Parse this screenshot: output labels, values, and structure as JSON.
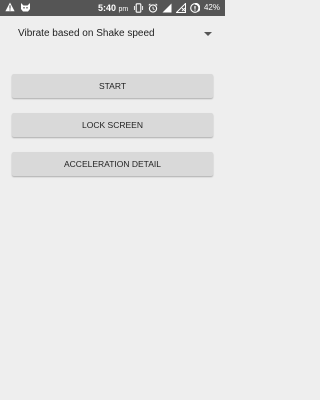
{
  "status_bar": {
    "time": "5:40",
    "ampm": "pm",
    "battery_percent": "42%",
    "left_icons": [
      "warning-icon",
      "cat-notification-icon"
    ],
    "right_icons": [
      "vibrate-icon",
      "alarm-icon",
      "signal-icon",
      "no-sim-icon",
      "battery-icon"
    ]
  },
  "spinner": {
    "selected_value": "Vibrate based on Shake speed"
  },
  "buttons": {
    "start": "START",
    "lock_screen": "LOCK SCREEN",
    "acceleration_detail": "ACCELERATION DETAIL"
  },
  "colors": {
    "status_bar": "#555555",
    "background": "#eeeeee",
    "button": "#d9d9d9"
  }
}
